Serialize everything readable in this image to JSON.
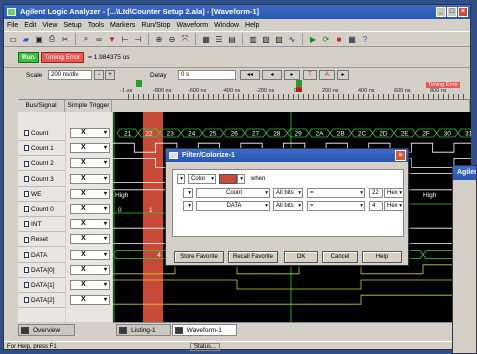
{
  "window": {
    "title": "Agilent Logic Analyzer - [...\\Ltd\\Counter Setup 2.ala] - [Waveform-1]"
  },
  "menu": [
    "File",
    "Edit",
    "View",
    "Setup",
    "Tools",
    "Markers",
    "Run/Stop",
    "Waveform",
    "Window",
    "Help"
  ],
  "toolbar2": {
    "run": "Run",
    "timing_error": "Timing Error",
    "value": "= 1.984375 us"
  },
  "scale": {
    "label": "Scale",
    "value": "200 ns/div",
    "delay_label": "Delay",
    "delay_value": "0 s",
    "ruler": [
      "-1 us",
      "-800 ns",
      "-600 ns",
      "-400 ns",
      "-200 ns",
      "0 s",
      "200 ns",
      "400 ns",
      "600 ns",
      "800 ns"
    ],
    "marker": "Timing Error"
  },
  "headers": {
    "bus": "Bus/Signal",
    "trigger": "Simple Trigger"
  },
  "signals": [
    {
      "name": "Count",
      "trigger": "X",
      "bus": true
    },
    {
      "name": "Count 1",
      "trigger": "X"
    },
    {
      "name": "Count 2",
      "trigger": "X"
    },
    {
      "name": "Count 3",
      "trigger": "X"
    },
    {
      "name": "WE",
      "trigger": "X"
    },
    {
      "name": "Count 0",
      "trigger": "X"
    },
    {
      "name": "INT",
      "trigger": "X"
    },
    {
      "name": "Reset",
      "trigger": "X"
    },
    {
      "name": "DATA",
      "trigger": "X",
      "bus": true
    },
    {
      "name": "DATA[0]",
      "trigger": "X"
    },
    {
      "name": "DATA[1]",
      "trigger": "X"
    },
    {
      "name": "DATA[2]",
      "trigger": "X"
    }
  ],
  "count_values": [
    "21",
    "22",
    "23",
    "24",
    "25",
    "26",
    "27",
    "28",
    "29",
    "2A",
    "2B",
    "2C",
    "2D",
    "2E",
    "2F",
    "30",
    "31"
  ],
  "waveform_labels": {
    "we_high_left": "High",
    "we_high_right": "High",
    "c0_zero": "0",
    "c0_one": "1",
    "data_4": "4"
  },
  "dialog": {
    "title": "Filter/Colorize-1",
    "color_label": "Color",
    "when_label": "when",
    "row1": {
      "signal": "Count",
      "bits": "All bits",
      "op": "=",
      "value": "22",
      "base": "Hex"
    },
    "row2": {
      "signal": "DATA",
      "bits": "All bits",
      "op": "=",
      "value": "4",
      "base": "Hex"
    },
    "buttons": {
      "store": "Store Favorite",
      "recall": "Recall Favorite",
      "ok": "OK",
      "cancel": "Cancel",
      "help": "Help"
    },
    "highlight_color": "#c84b3a"
  },
  "tabs": [
    "Overview",
    "Listing-1",
    "Waveform-1"
  ],
  "status": {
    "help": "For Help, press F1",
    "status_btn": "Status..."
  },
  "second_window": {
    "title": "Agilent"
  }
}
